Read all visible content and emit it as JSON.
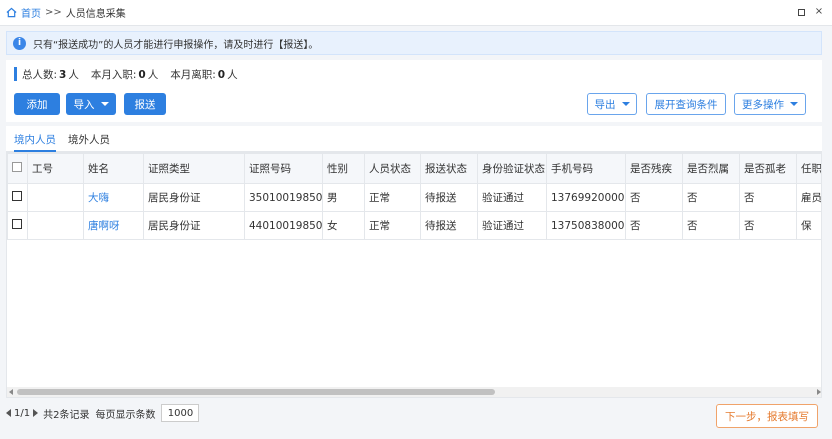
{
  "breadcrumb": {
    "home": "首页",
    "separator": ">>",
    "current": "人员信息采集"
  },
  "window": {
    "restore_symbol": "",
    "close_symbol": "×"
  },
  "notice": {
    "icon": "i",
    "text": "只有“报送成功”的人员才能进行申报操作，请及时进行【报送】。"
  },
  "stats": {
    "total_label": "总人数:",
    "total_value": "3",
    "total_unit": "人",
    "joined_label": "本月入职:",
    "joined_value": "0",
    "joined_unit": "人",
    "left_label": "本月离职:",
    "left_value": "0",
    "left_unit": "人"
  },
  "toolbar": {
    "add_label": "添加",
    "import_label": "导入",
    "submit_label": "报送",
    "export_label": "导出",
    "expand_query_label": "展开查询条件",
    "more_label": "更多操作"
  },
  "tabs": [
    {
      "label": "境内人员",
      "active": true
    },
    {
      "label": "境外人员",
      "active": false
    }
  ],
  "table": {
    "columns": [
      "工号",
      "姓名",
      "证照类型",
      "证照号码",
      "性别",
      "人员状态",
      "报送状态",
      "身份验证状态",
      "手机号码",
      "是否残疾",
      "是否烈属",
      "是否孤老",
      "任职"
    ],
    "rows": [
      {
        "id": "",
        "name": "大嗨",
        "id_type": "居民身份证",
        "id_number": "35010019850...",
        "gender": "男",
        "status": "正常",
        "submit_status": "待报送",
        "verify_status": "验证通过",
        "phone": "13769920000",
        "disabled": "否",
        "martyr": "否",
        "elderly": "否",
        "employ": "雇员"
      },
      {
        "id": "",
        "name": "唐啊呀",
        "id_type": "居民身份证",
        "id_number": "44010019850...",
        "gender": "女",
        "status": "正常",
        "submit_status": "待报送",
        "verify_status": "验证通过",
        "phone": "13750838000",
        "disabled": "否",
        "martyr": "否",
        "elderly": "否",
        "employ": "保"
      }
    ]
  },
  "pager": {
    "page": "1/1",
    "records": "共2条记录",
    "per_page_label": "每页显示条数",
    "per_page_value": "1000"
  },
  "next_step": {
    "label": "下一步，报表填写"
  },
  "colors": {
    "primary": "#2d7fe0",
    "notice_bg": "#e8f1fd",
    "next_border": "#f0a36a",
    "next_text": "#e57a2e"
  }
}
